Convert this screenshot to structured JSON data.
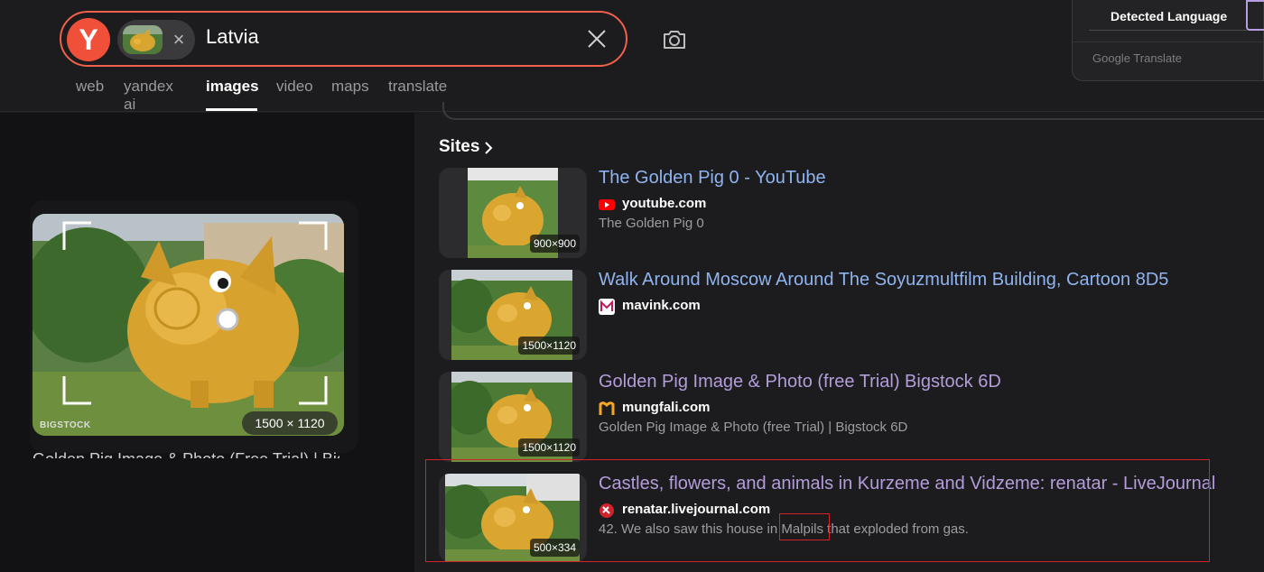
{
  "search": {
    "query": "Latvia",
    "logo": "Y",
    "chip_remove": "×",
    "icons": {
      "clear": "close-icon",
      "camera": "camera-icon",
      "remove": "close-icon"
    }
  },
  "tabs": [
    {
      "label": "web",
      "active": false
    },
    {
      "label": "yandex ai",
      "active": false
    },
    {
      "label": "images",
      "active": true
    },
    {
      "label": "video",
      "active": false
    },
    {
      "label": "maps",
      "active": false
    },
    {
      "label": "translate",
      "active": false
    }
  ],
  "translate_popup": {
    "detected_language": "Detected Language",
    "provider": "Google Translate"
  },
  "preview": {
    "size": "1500 × 1120",
    "watermark": "BIGSTOCK",
    "caption": "Golden Pig Image & Photo (Free Trial) | Bigstock"
  },
  "sites_heading": "Sites",
  "results": [
    {
      "title": "The Golden Pig 0 - YouTube",
      "source": "youtube.com",
      "description": "The Golden Pig 0",
      "size": "900×900",
      "visited": false,
      "icon": "youtube-icon",
      "icon_color": "#ff0000"
    },
    {
      "title": "Walk Around Moscow Around The Soyuzmultfilm Building, Cartoon 8D5",
      "source": "mavink.com",
      "description": "",
      "size": "1500×1120",
      "visited": false,
      "icon": "mavink-icon",
      "icon_color": "#ffffff"
    },
    {
      "title": "Golden Pig Image & Photo (free Trial) Bigstock 6D",
      "source": "mungfali.com",
      "description": "Golden Pig Image & Photo (free Trial) | Bigstock 6D",
      "size": "1500×1120",
      "visited": true,
      "icon": "mungfali-icon",
      "icon_color": "#f5a623"
    },
    {
      "title": "Castles, flowers, and animals in Kurzeme and Vidzeme: renatar - LiveJournal",
      "source": "renatar.livejournal.com",
      "description": "42. We also saw this house in Malpils that exploded from gas.",
      "size": "500×334",
      "visited": true,
      "icon": "livejournal-icon",
      "icon_color": "#d0232b"
    }
  ],
  "colors": {
    "accent": "#f0503a",
    "visited_link": "#b39ddb",
    "link": "#8fb4f0",
    "highlight": "#d0232b"
  }
}
